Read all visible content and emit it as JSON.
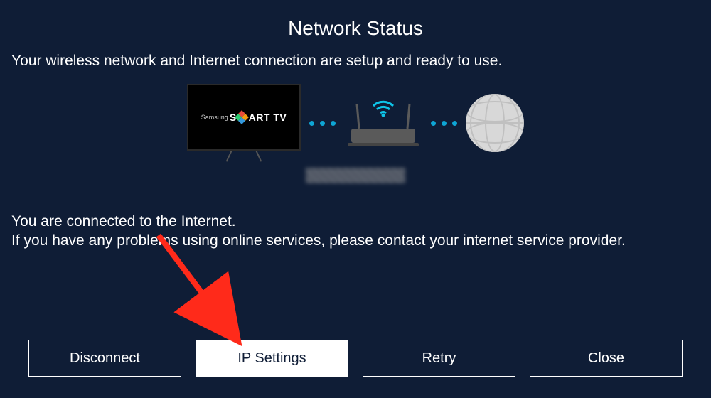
{
  "title": "Network Status",
  "subtitle": "Your wireless network and Internet connection are setup and ready to use.",
  "tv": {
    "brand": "Samsung",
    "logo_prefix": "S",
    "logo_suffix": "ART TV"
  },
  "status": {
    "line1": "You are connected to the Internet.",
    "line2": "If you have any problems using online services, please contact your internet service provider."
  },
  "buttons": {
    "disconnect": "Disconnect",
    "ip_settings": "IP Settings",
    "retry": "Retry",
    "close": "Close"
  },
  "annotation": {
    "arrow_color": "#ff2a1a"
  }
}
